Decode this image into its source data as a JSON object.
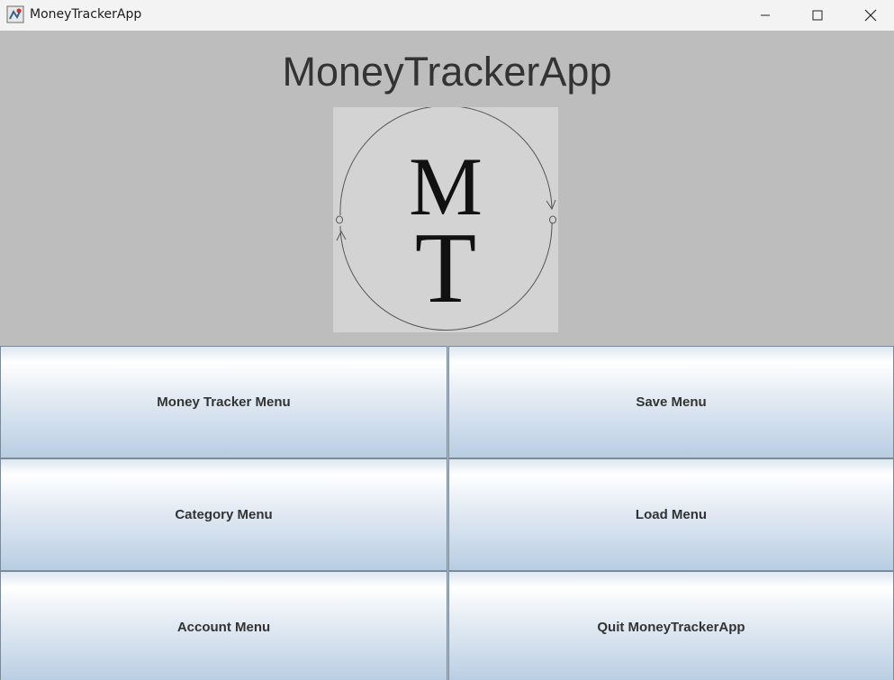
{
  "window": {
    "title": "MoneyTrackerApp",
    "controls": {
      "minimize": "minimize-icon",
      "maximize": "maximize-icon",
      "close": "close-icon"
    }
  },
  "main": {
    "heading": "MoneyTrackerApp",
    "logo": {
      "letters_top": "M",
      "letters_bottom": "T"
    }
  },
  "menu": {
    "money_tracker": "Money Tracker Menu",
    "save": "Save Menu",
    "category": "Category Menu",
    "load": "Load Menu",
    "account": "Account Menu",
    "quit": "Quit MoneyTrackerApp"
  },
  "colors": {
    "background": "#bdbdbd",
    "titlebar": "#f3f3f3",
    "logo_bg": "#d3d3d3"
  }
}
